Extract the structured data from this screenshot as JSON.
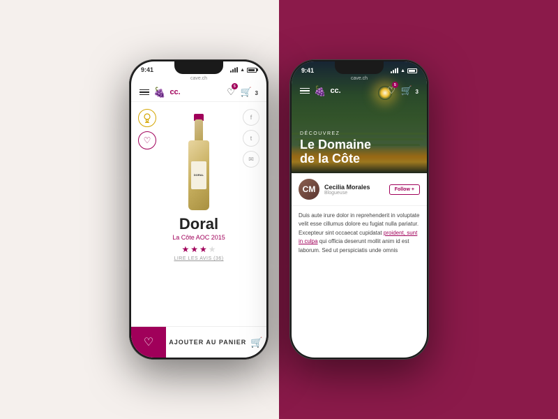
{
  "background": {
    "left_color": "#f5f0ed",
    "right_color": "#8b1a4a"
  },
  "phone1": {
    "status": {
      "time": "9:41",
      "url": "cave.ch",
      "signal": "●●●",
      "wifi": "wifi",
      "battery": "75"
    },
    "nav": {
      "logo": "🍇",
      "logo_text": "cc.",
      "wishlist_count": "5",
      "cart_count": "3"
    },
    "wine": {
      "name": "Doral",
      "subtitle": "La Côte AOC 2015",
      "stars_filled": 3,
      "stars_empty": 1,
      "total_stars": 4,
      "reviews_label": "LIRE LES AVIS (36)"
    },
    "footer": {
      "add_to_cart": "AJOUTER AU PANIER"
    },
    "award_icon": "🏅",
    "social_icons": [
      "f",
      "t",
      "✉"
    ]
  },
  "phone2": {
    "status": {
      "time": "9:41",
      "url": "cave.ch",
      "signal": "●●●",
      "wifi": "wifi",
      "battery": "75"
    },
    "nav": {
      "logo": "🍇",
      "logo_text": "cc.",
      "wishlist_count": "5",
      "cart_count": "3"
    },
    "hero": {
      "discover_label": "DÉCOUVREZ",
      "title_line1": "Le Domaine",
      "title_line2": "de la Côte"
    },
    "author": {
      "name": "Cecilia Morales",
      "role": "Blogueuse",
      "initials": "CM",
      "follow_label": "Follow",
      "follow_icon": "+"
    },
    "article": {
      "text": "Duis aute irure dolor in reprehenderit in voluptate velit esse cillumus dolore eu fugiat nulla pariatur. Excepteur sint occaecat cupidatat proident, sunt in culpa qui officia deserunt mollit anim id est laborum. Sed ut perspiciatis unde omnis",
      "highlight_word": "proident, sunt in culpa"
    }
  }
}
